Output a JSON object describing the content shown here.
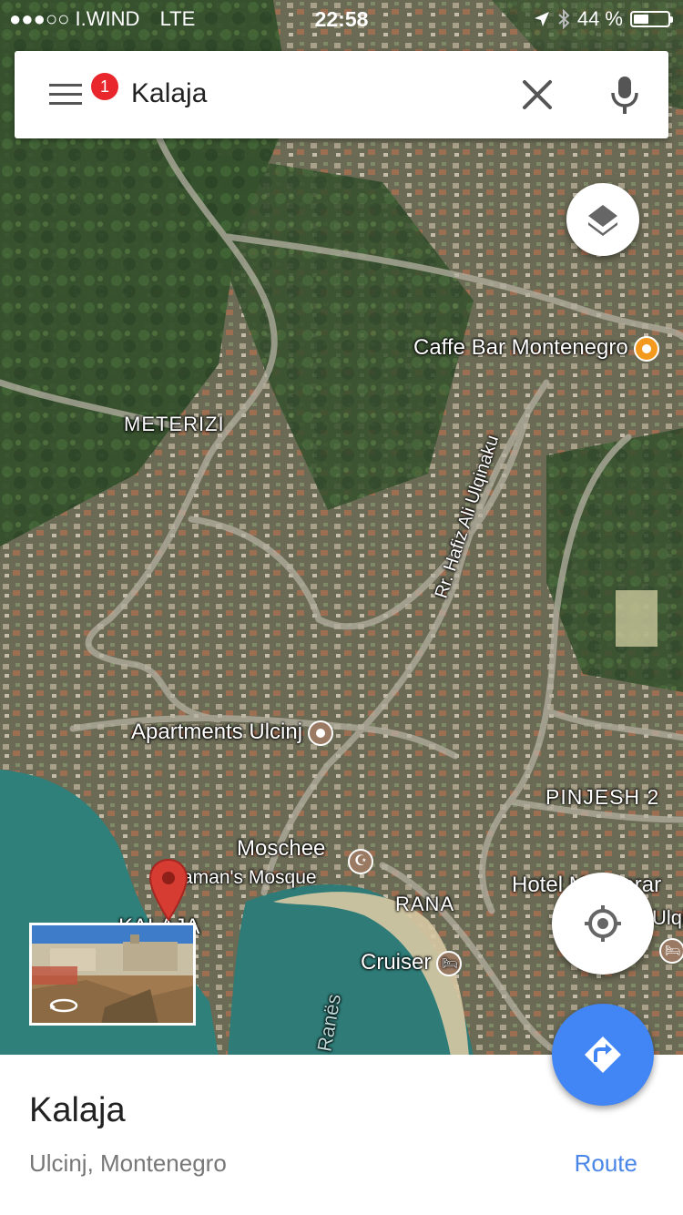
{
  "status_bar": {
    "carrier": "●●●○○ I.WIND",
    "network": "LTE",
    "time": "22:58",
    "battery": "44 %",
    "battery_level": 0.44
  },
  "search": {
    "query": "Kalaja",
    "menu_badge": "1"
  },
  "map": {
    "labels": {
      "caffe_bar": "Caffe Bar Montenegro",
      "meterizi": "METERIZI",
      "street": "Rr. Hafiz Ali Ulqinaku",
      "apartments": "Apartments Ulcinj",
      "pinjesh": "PINJESH 2",
      "moschee": "Moschee",
      "mosque": "aman's Mosque",
      "rana": "RANA",
      "hotel": "Hotel Mediterar",
      "ulcinj": "Ulqin",
      "cruiser": "Cruiser",
      "kalaja": "KALAJA",
      "bay": "Ranës"
    }
  },
  "place": {
    "name": "Kalaja",
    "location": "Ulcinj, Montenegro",
    "route_label": "Route"
  },
  "colors": {
    "route_blue": "#4285f4",
    "route_text": "#4a86e8",
    "badge_red": "#e8262b",
    "pin_red": "#d63c32",
    "sea": "#2f7f7a"
  }
}
